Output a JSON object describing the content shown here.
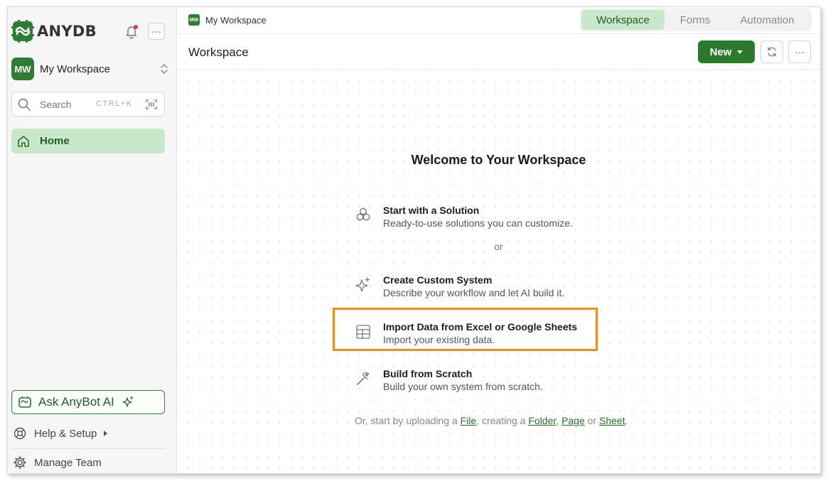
{
  "brand": {
    "name": "ANYDB"
  },
  "workspace": {
    "avatar": "MW",
    "name": "My Workspace"
  },
  "search": {
    "placeholder": "Search",
    "shortcut": "CTRL+K"
  },
  "nav": {
    "home": "Home"
  },
  "sidebar_footer": {
    "ask": "Ask AnyBot AI",
    "help": "Help & Setup",
    "team": "Manage Team"
  },
  "topbar": {
    "crumb_avatar": "MW",
    "crumb_label": "My Workspace",
    "tabs": [
      "Workspace",
      "Forms",
      "Automation"
    ],
    "active_tab": "Workspace"
  },
  "header": {
    "title": "Workspace",
    "new_label": "New"
  },
  "welcome": {
    "heading": "Welcome to Your Workspace",
    "or": "or",
    "options": [
      {
        "title": "Start with a Solution",
        "desc": "Ready-to-use solutions you can customize.",
        "icon": "cubes-icon"
      },
      {
        "title": "Create Custom System",
        "desc": "Describe your workflow and let AI build it.",
        "icon": "sparkle-icon"
      },
      {
        "title": "Import Data from Excel or Google Sheets",
        "desc": "Import your existing data.",
        "icon": "table-icon"
      },
      {
        "title": "Build from Scratch",
        "desc": "Build your own system from scratch.",
        "icon": "tools-icon"
      }
    ],
    "footer": {
      "prefix": "Or, start by uploading a ",
      "file": "File",
      "mid1": ", creating a ",
      "folder": "Folder",
      "comma": ", ",
      "page": "Page",
      "or": " or ",
      "sheet": "Sheet",
      "end": "."
    }
  },
  "colors": {
    "brand_green": "#2b7a2b",
    "active_bg": "#c9e8c9",
    "highlight": "#f08c1a",
    "notification": "#e53935"
  }
}
